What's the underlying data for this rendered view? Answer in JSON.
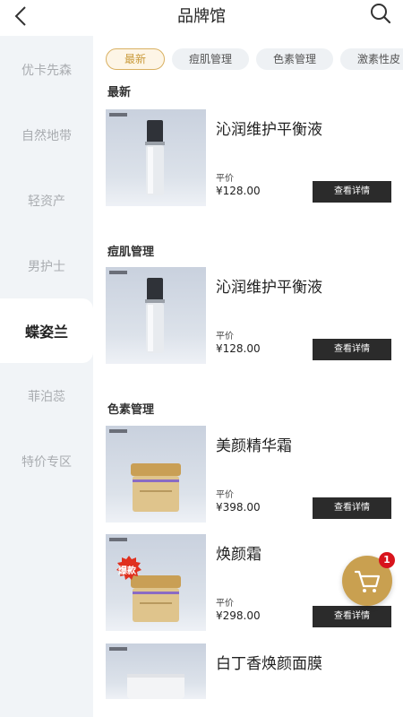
{
  "header": {
    "title": "品牌馆",
    "back_icon": "back-arrow-icon",
    "search_icon": "search-icon"
  },
  "sidebar": {
    "items": [
      {
        "label": "优卡先森",
        "active": false
      },
      {
        "label": "自然地带",
        "active": false
      },
      {
        "label": "轻资产",
        "active": false
      },
      {
        "label": "男护士",
        "active": false
      },
      {
        "label": "蝶姿兰",
        "active": true
      },
      {
        "label": "菲泊蕊",
        "active": false
      },
      {
        "label": "特价专区",
        "active": false
      }
    ]
  },
  "tabs": [
    {
      "label": "最新",
      "active": true
    },
    {
      "label": "痘肌管理",
      "active": false
    },
    {
      "label": "色素管理",
      "active": false
    },
    {
      "label": "激素性皮",
      "active": false
    }
  ],
  "sections": [
    {
      "title": "最新",
      "products": [
        {
          "name": "沁润维护平衡液",
          "price_label": "平价",
          "price": "¥128.00",
          "button": "查看详情",
          "image": "silver-bottle"
        }
      ]
    },
    {
      "title": "痘肌管理",
      "products": [
        {
          "name": "沁润维护平衡液",
          "price_label": "平价",
          "price": "¥128.00",
          "button": "查看详情",
          "image": "silver-bottle"
        }
      ]
    },
    {
      "title": "色素管理",
      "products": [
        {
          "name": "美颜精华霜",
          "price_label": "平价",
          "price": "¥398.00",
          "button": "查看详情",
          "image": "gold-jar"
        },
        {
          "name": "焕颜霜",
          "price_label": "平价",
          "price": "¥298.00",
          "button": "查看详情",
          "image": "gold-jar",
          "badge": "爆款"
        },
        {
          "name": "白丁香焕颜面膜",
          "image": "white-jar"
        }
      ]
    }
  ],
  "cart": {
    "icon": "cart-icon",
    "count": "1"
  },
  "colors": {
    "accent": "#c9a050",
    "badge": "#d8141c",
    "button": "#2b2b2b",
    "sidebar_bg": "#f1f4f7",
    "hot_badge": "#e0301e"
  }
}
